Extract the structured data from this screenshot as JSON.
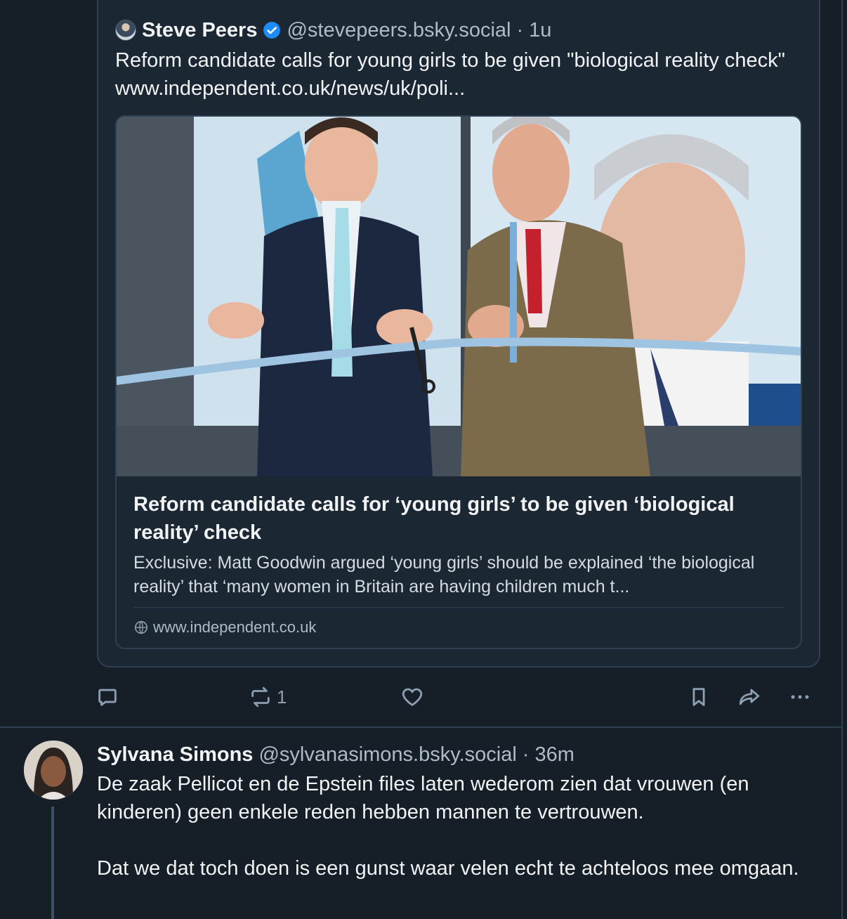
{
  "quote": {
    "author_name": "Steve Peers",
    "handle": "@stevepeers.bsky.social",
    "dot": "·",
    "time": "1u",
    "text": "Reform candidate calls for young girls to be given \"biological reality check\" www.independent.co.uk/news/uk/poli...",
    "link_card": {
      "title": "Reform candidate calls for ‘young girls’ to be given ‘biological reality’ check",
      "description": "Exclusive: Matt Goodwin argued ‘young girls’ should be explained ‘the biological reality’ that ‘many women in Britain are having children much t...",
      "domain": "www.independent.co.uk"
    }
  },
  "actions": {
    "reply_icon": "comment-bubble-icon",
    "repost_icon": "repost-icon",
    "repost_count": "1",
    "like_icon": "heart-icon",
    "bookmark_icon": "bookmark-icon",
    "share_icon": "share-arrow-icon",
    "more_icon": "ellipsis-icon"
  },
  "post": {
    "author_name": "Sylvana Simons",
    "handle": "@sylvanasimons.bsky.social",
    "dot": "·",
    "time": "36m",
    "paragraphs": [
      "De zaak Pellicot en de Epstein files laten wederom zien dat vrouwen (en kinderen) geen enkele reden hebben mannen te vertrouwen.",
      "Dat we dat toch doen is een gunst waar velen echt te achteloos mee omgaan."
    ]
  },
  "colors": {
    "background": "#161e27",
    "card_background": "#1b2733",
    "border": "#2e4052",
    "muted_text": "#aebbc9",
    "verified_blue": "#1d8cf8"
  }
}
